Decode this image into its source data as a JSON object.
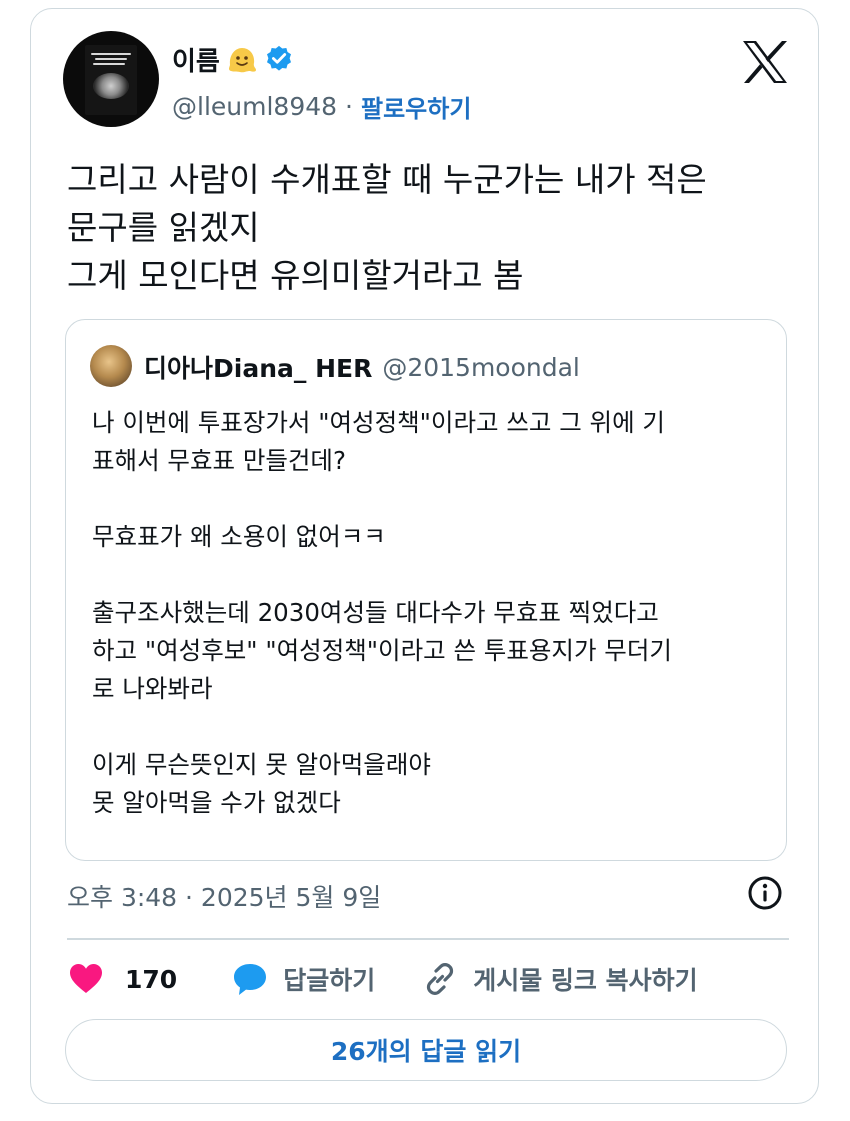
{
  "author": {
    "name": "이름",
    "handle": "@lleuml8948",
    "separator": "·",
    "follow_label": "팔로우하기",
    "avatar_icon": "book-cover-avatar",
    "name_emoji": "melting-face-emoji",
    "verified_icon": "verified-badge-icon",
    "verified_color": "#1d9bf0"
  },
  "platform_icon": "x-logo-icon",
  "tweet": {
    "lines": [
      "그리고 사람이 수개표할 때 누군가는 내가 적은",
      "문구를 읽겠지",
      "그게 모인다면 유의미할거라고 봄"
    ]
  },
  "quote": {
    "name": "디아나Diana_ HER",
    "handle": "@2015moondal",
    "lines": [
      "나 이번에 투표장가서 \"여성정책\"이라고 쓰고 그 위에 기",
      "표해서 무효표 만들건데?",
      "",
      "무효표가 왜 소용이 없어ㅋㅋ",
      "",
      "출구조사했는데 2030여성들 대다수가 무효표 찍었다고",
      "하고 \"여성후보\" \"여성정책\"이라고 쓴 투표용지가 무더기",
      "로 나와봐라",
      "",
      "이게 무슨뜻인지 못 알아먹을래야",
      "못 알아먹을 수가 없겠다"
    ]
  },
  "timestamp": "오후 3:48 · 2025년 5월 9일",
  "actions": {
    "like_count": "170",
    "reply_label": "답글하기",
    "copy_label": "게시물 링크 복사하기",
    "like_color": "#f91880",
    "reply_color": "#1d9bf0"
  },
  "read_replies_label": "26개의 답글 읽기",
  "colors": {
    "link_blue": "#1d6fc2",
    "border": "#cfd9de",
    "secondary_text": "#536471"
  }
}
